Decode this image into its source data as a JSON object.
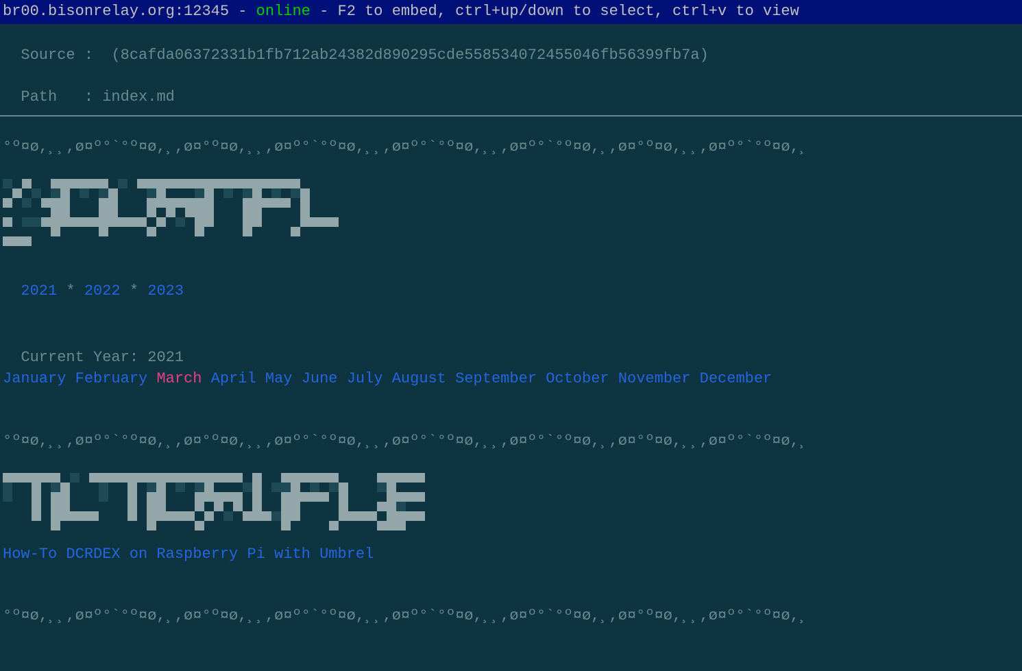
{
  "header": {
    "server": "br00.bisonrelay.org:12345",
    "sep1": " - ",
    "status": "online",
    "sep2": " - ",
    "hint": "F2 to embed, ctrl+up/down to select, ctrl+v to view"
  },
  "meta": {
    "source_label": "Source :  ",
    "source_value": "(8cafda06372331b1fb712ab24382d890295cde558534072455046fb56399fb7a)",
    "path_label": "Path   : ",
    "path_value": "index.md"
  },
  "wave": "°º¤ø,¸¸,ø¤º°`°º¤ø,¸,ø¤°º¤ø,¸¸,ø¤º°`°º¤ø,¸¸,ø¤º°`°º¤ø,¸¸,ø¤º°`°º¤ø,¸,ø¤°º¤ø,¸¸,ø¤º°`°º¤ø,¸",
  "journal": {
    "years": [
      "2021",
      "2022",
      "2023"
    ],
    "year_sep": " * ",
    "current_label": "Current Year: ",
    "current_year": "2021",
    "months": [
      "January",
      "February",
      "March",
      "April",
      "May",
      "June",
      "July",
      "August",
      "September",
      "October",
      "November",
      "December"
    ],
    "selected_month_index": 2
  },
  "tutorials": {
    "links": [
      {
        "text": "How-To DCRDEX on Raspberry Pi with Umbrel"
      }
    ]
  },
  "bigletters": {
    "j": "d.f...f.d.f.d.f.....f.ddf.....fff",
    "o": "fffffdf.d.ff...ff...ffffff",
    "u": "f.d.fdf...ff...ff...ffffff",
    "r": "fffffdf...ffffff.f.f.f.d.f",
    "n": "fffffdf.d.ff...ff...ff...f",
    "a": "fffffdf.d.fffffff...ff...f",
    "l": "f....df....f....f....fffff",
    "t": "fffffd..f.d..f....f....f..",
    "i": ".f..df.d.f...f..fffd",
    "i_cols": 4,
    "s": "fffffdf....ffffffd...fffffff"
  }
}
